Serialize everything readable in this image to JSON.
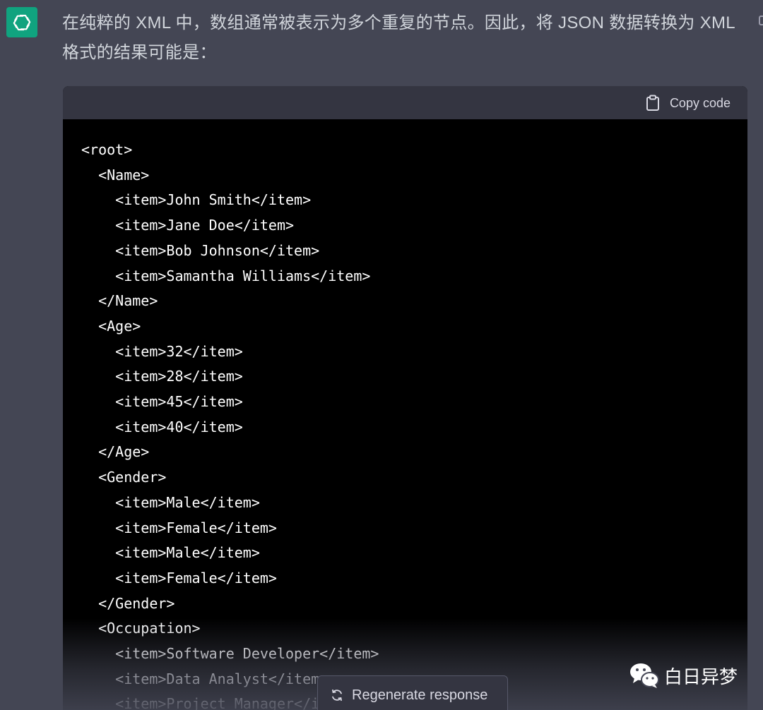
{
  "message": {
    "intro": "在纯粹的 XML 中，数组通常被表示为多个重复的节点。因此，将 JSON 数据转换为 XML 格式的结果可能是："
  },
  "code_block": {
    "copy_label": "Copy code",
    "code": "<root>\n  <Name>\n    <item>John Smith</item>\n    <item>Jane Doe</item>\n    <item>Bob Johnson</item>\n    <item>Samantha Williams</item>\n  </Name>\n  <Age>\n    <item>32</item>\n    <item>28</item>\n    <item>45</item>\n    <item>40</item>\n  </Age>\n  <Gender>\n    <item>Male</item>\n    <item>Female</item>\n    <item>Male</item>\n    <item>Female</item>\n  </Gender>\n  <Occupation>\n    <item>Software Developer</item>\n    <item>Data Analyst</item>\n    <item>Project Manager</item>"
  },
  "actions": {
    "regenerate_label": "Regenerate response"
  },
  "watermark": {
    "text": "白日异梦"
  },
  "colors": {
    "page_bg": "#444654",
    "header_bg": "#343541",
    "code_bg": "#000000",
    "avatar_bg": "#10a37f"
  }
}
